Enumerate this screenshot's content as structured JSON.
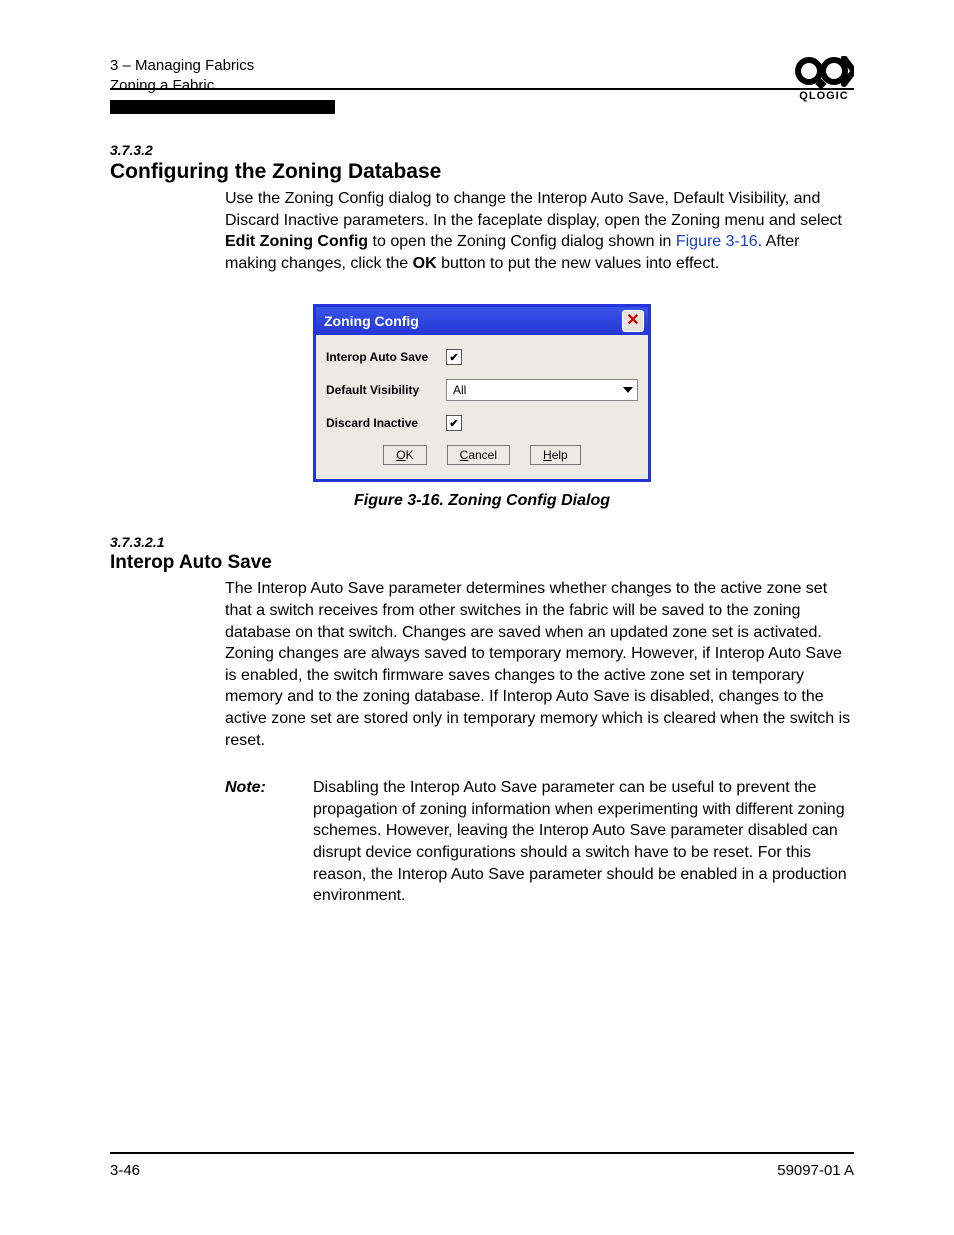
{
  "header": {
    "chapter_line": "3 – Managing Fabrics",
    "section_line": "Zoning a Fabric",
    "logo_text": "QLOGIC"
  },
  "section1": {
    "num": "3.7.3.2",
    "title": "Configuring the Zoning Database",
    "para_pre": "Use the Zoning Config dialog to change the Interop Auto Save, Default Visibility, and Discard Inactive parameters. In the faceplate display, open the Zoning menu and select ",
    "bold1": "Edit Zoning Config",
    "para_mid": " to open the Zoning Config dialog shown in ",
    "figref": "Figure 3-16",
    "para_post": ". After making changes, click the ",
    "bold2": "OK",
    "para_end": " button to put the new values into effect."
  },
  "dialog": {
    "title": "Zoning Config",
    "row1_label": "Interop Auto Save",
    "row1_checked": "✔",
    "row2_label": "Default Visibility",
    "row2_value": "All",
    "row3_label": "Discard Inactive",
    "row3_checked": "✔",
    "btn_ok_u": "O",
    "btn_ok_rest": "K",
    "btn_cancel_u": "C",
    "btn_cancel_rest": "ancel",
    "btn_help_u": "H",
    "btn_help_rest": "elp"
  },
  "fig_caption": "Figure 3-16.  Zoning Config Dialog",
  "section2": {
    "num": "3.7.3.2.1",
    "title": "Interop Auto Save",
    "para": "The Interop Auto Save parameter determines whether changes to the active zone set that a switch receives from other switches in the fabric will be saved to the zoning database on that switch. Changes are saved when an updated zone set is activated. Zoning changes are always saved to temporary memory. However, if Interop Auto Save is enabled, the switch firmware saves changes to the active zone set in temporary memory and to the zoning database. If Interop Auto Save is disabled, changes to the active zone set are stored only in temporary memory which is cleared when the switch is reset."
  },
  "note": {
    "label": "Note:",
    "text": "Disabling the Interop Auto Save parameter can be useful to prevent the propagation of zoning information when experimenting with different zoning schemes. However, leaving the Interop Auto Save parameter disabled can disrupt device configurations should a switch have to be reset. For this reason, the Interop Auto Save parameter should be enabled in a production environment."
  },
  "footer": {
    "page": "3-46",
    "docid": "59097-01 A"
  }
}
